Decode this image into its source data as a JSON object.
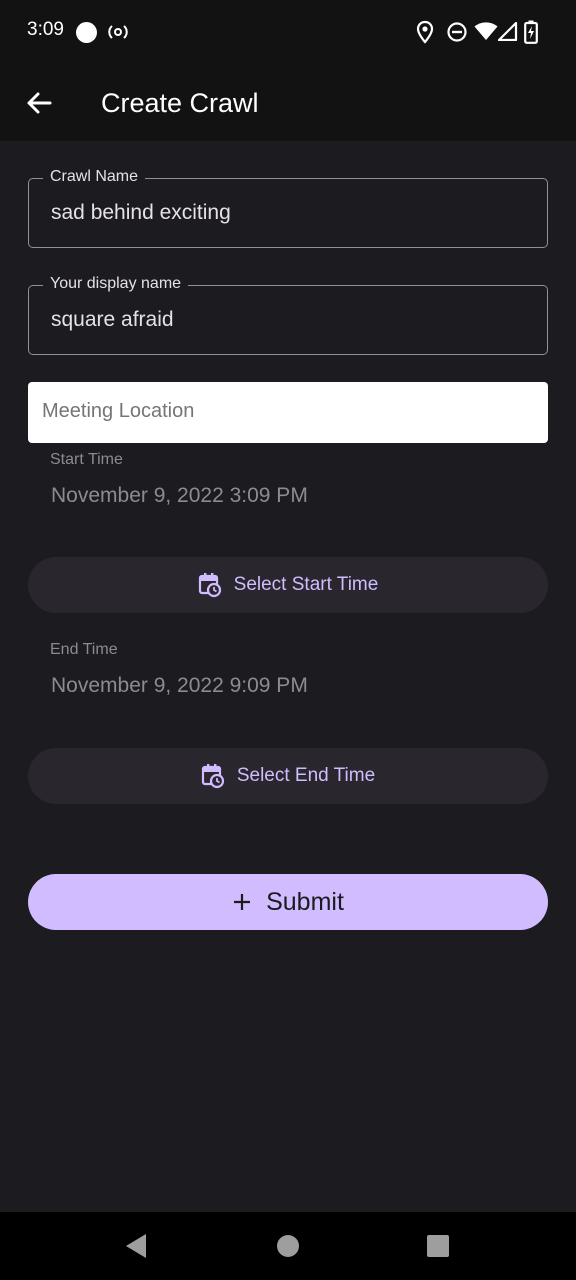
{
  "status_bar": {
    "time": "3:09",
    "icons": [
      "circle-icon",
      "hotspot-icon",
      "location-icon",
      "dnd-icon",
      "wifi-icon",
      "signal-icon",
      "battery-icon"
    ]
  },
  "app_bar": {
    "title": "Create Crawl",
    "back_icon": "arrow-left-icon"
  },
  "form": {
    "crawl_name": {
      "label": "Crawl Name",
      "value": "sad behind exciting"
    },
    "display_name": {
      "label": "Your display name",
      "value": "square afraid"
    },
    "meeting_location": {
      "placeholder": "Meeting Location",
      "value": ""
    },
    "start_time": {
      "label": "Start Time",
      "value": "November 9, 2022 3:09 PM",
      "button_label": "Select Start Time"
    },
    "end_time": {
      "label": "End Time",
      "value": "November 9, 2022 9:09 PM",
      "button_label": "Select End Time"
    },
    "submit": {
      "label": "Submit",
      "icon": "plus-icon"
    }
  },
  "nav_bar": {
    "icons": [
      "back-triangle-icon",
      "home-circle-icon",
      "recents-square-icon"
    ]
  },
  "colors": {
    "background": "#1c1b20",
    "app_bar": "#121212",
    "accent": "#d0bcff",
    "tonal_button": "#29262d",
    "outline": "#938f99"
  }
}
